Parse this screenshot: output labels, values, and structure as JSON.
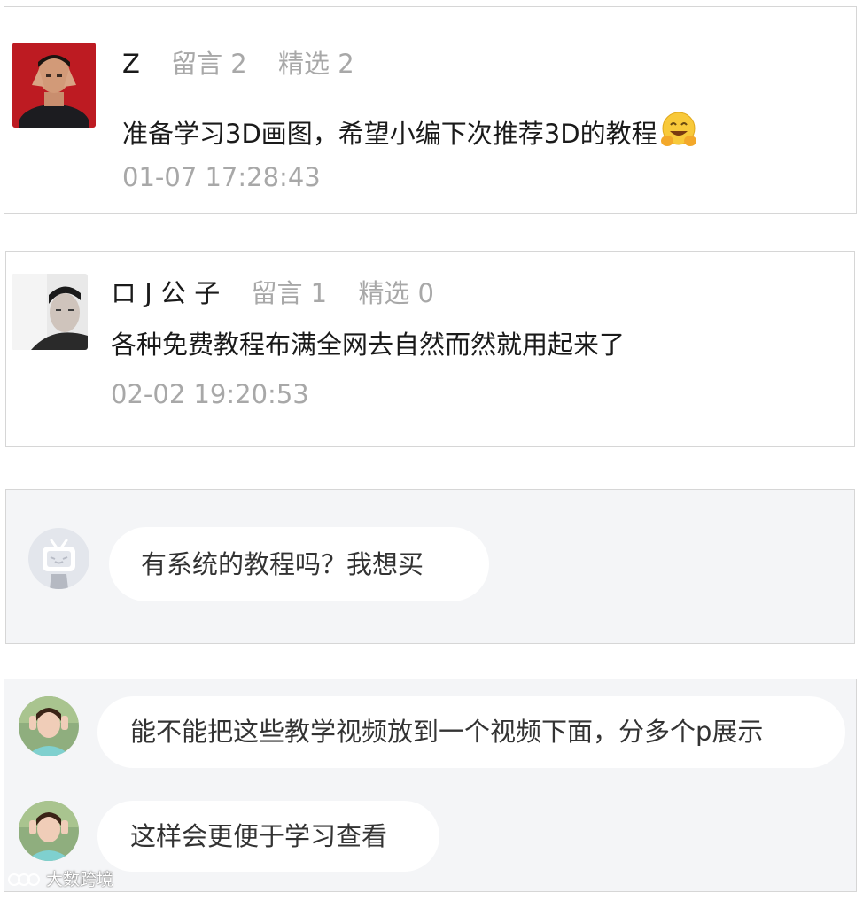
{
  "comments": [
    {
      "name": "Z",
      "likes_label": "留言 2",
      "featured_label": "精选 2",
      "text": "准备学习3D画图，希望小编下次推荐3D的教程",
      "emoji": "hugging-face-emoji",
      "time": "01-07 17:28:43"
    },
    {
      "name": "ロ J 公 子",
      "likes_label": "留言 1",
      "featured_label": "精选 0",
      "text": "各种免费教程布满全网去自然而然就用起来了",
      "time": "02-02 19:20:53"
    }
  ],
  "chat_a": {
    "avatar_icon": "bilibili-tv-avatar-icon",
    "messages": [
      "有系统的教程吗？我想买"
    ]
  },
  "chat_b": {
    "messages": [
      "能不能把这些教学视频放到一个视频下面，分多个p展示",
      "这样会更便于学习查看"
    ]
  },
  "watermark": "大数跨境",
  "colors": {
    "card_gray": "#f4f5f7",
    "meta_gray": "#a8a8a8",
    "text": "#1a1a1a",
    "border": "#d6d6d6"
  }
}
